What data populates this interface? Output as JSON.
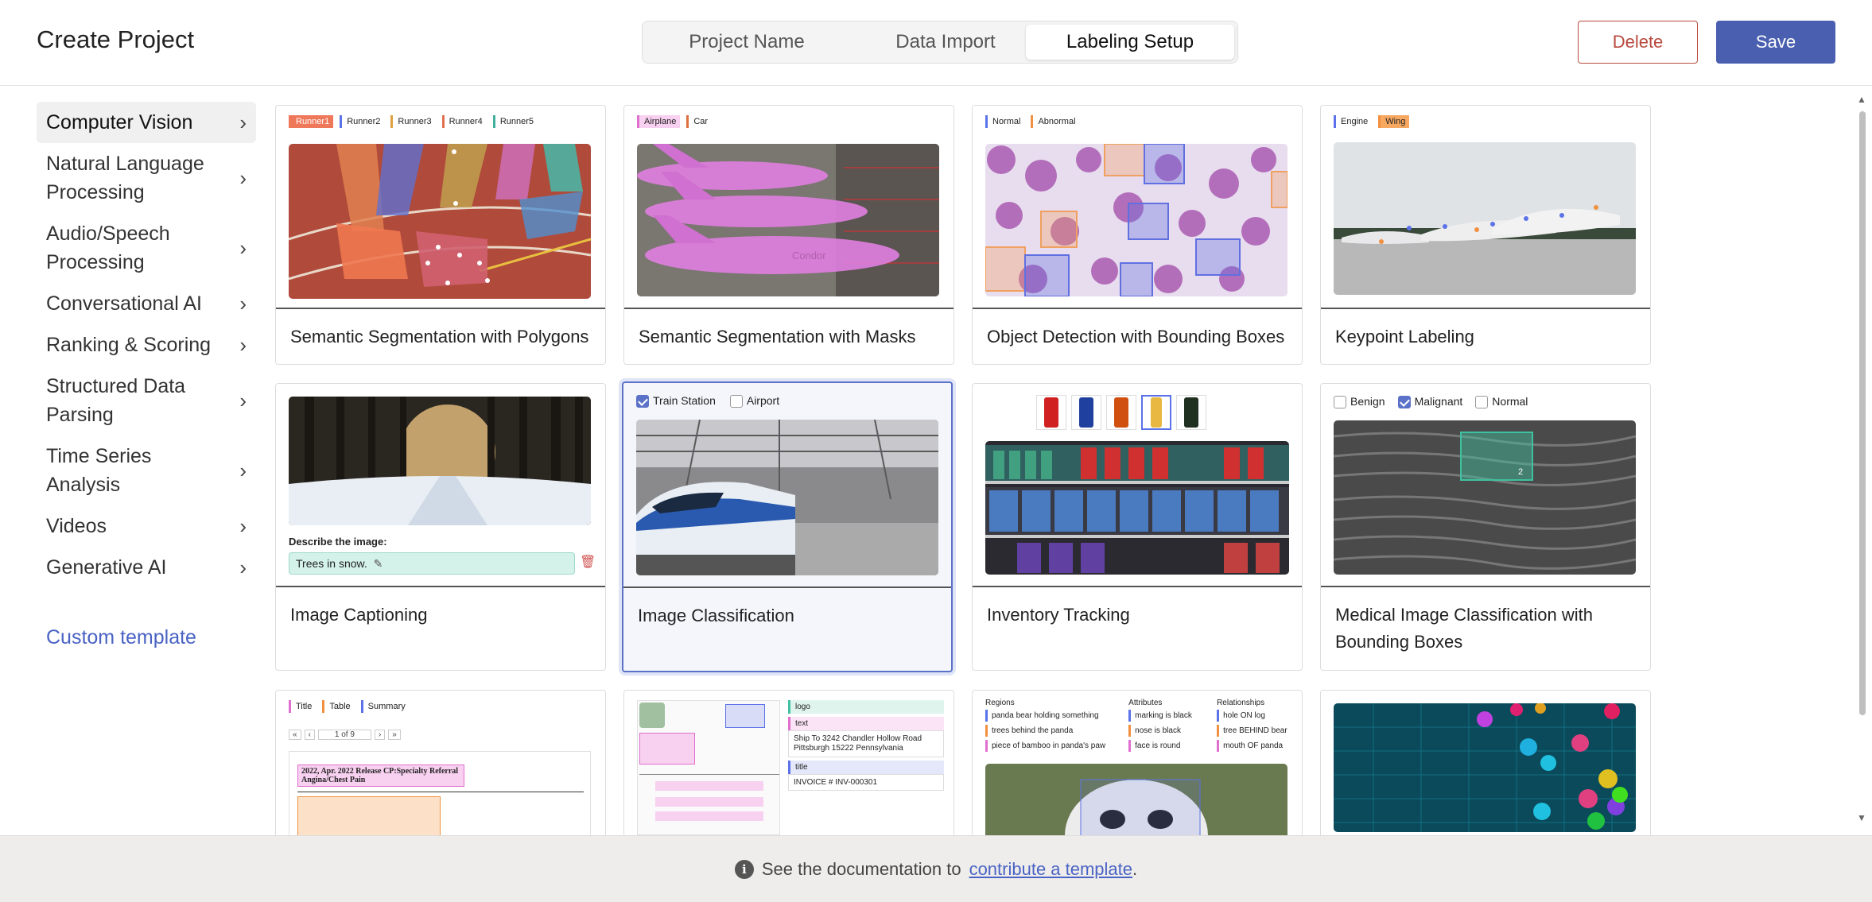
{
  "header": {
    "title": "Create Project",
    "tabs": [
      {
        "label": "Project Name"
      },
      {
        "label": "Data Import"
      },
      {
        "label": "Labeling Setup"
      }
    ],
    "delete_label": "Delete",
    "save_label": "Save"
  },
  "sidebar": {
    "items": [
      {
        "label": "Computer Vision"
      },
      {
        "label": "Natural Language Processing"
      },
      {
        "label": "Audio/Speech Processing"
      },
      {
        "label": "Conversational AI"
      },
      {
        "label": "Ranking & Scoring"
      },
      {
        "label": "Structured Data Parsing"
      },
      {
        "label": "Time Series Analysis"
      },
      {
        "label": "Videos"
      },
      {
        "label": "Generative AI"
      }
    ],
    "custom_template": "Custom template"
  },
  "cards": {
    "c1": {
      "title": "Semantic Segmentation with Polygons",
      "tags": [
        "Runner1",
        "Runner2",
        "Runner3",
        "Runner4",
        "Runner5"
      ]
    },
    "c2": {
      "title": "Semantic Segmentation with Masks",
      "tags": [
        "Airplane",
        "Car"
      ]
    },
    "c3": {
      "title": "Object Detection with Bounding Boxes",
      "tags": [
        "Normal",
        "Abnormal"
      ]
    },
    "c4": {
      "title": "Keypoint Labeling",
      "tags": [
        "Engine",
        "Wing"
      ]
    },
    "c5": {
      "title": "Image Captioning",
      "prompt": "Describe the image:",
      "caption": "Trees in snow."
    },
    "c6": {
      "title": "Image Classification",
      "choices": [
        "Train Station",
        "Airport"
      ]
    },
    "c7": {
      "title": "Inventory Tracking"
    },
    "c8": {
      "title": "Medical Image Classification with Bounding Boxes",
      "choices": [
        "Benign",
        "Malignant",
        "Normal"
      ]
    },
    "c9": {
      "tags": [
        "Title",
        "Table",
        "Summary"
      ],
      "pager": "1 of 9",
      "doc_heading": "2022, Apr. 2022 Release CP:Specialty Referral Angina/Chest Pain"
    },
    "c10": {
      "fields": [
        "logo",
        "text",
        "title"
      ],
      "ship_to": "Ship To 3242 Chandler Hollow Road Pittsburgh 15222 Pennsylvania",
      "invoice": "INVOICE # INV-000301"
    },
    "c11": {
      "headers": [
        "Regions",
        "Attributes",
        "Relationships"
      ],
      "regions": [
        "panda bear holding something",
        "trees behind the panda",
        "piece of bamboo in panda's paw"
      ],
      "attributes": [
        "marking is black",
        "nose is black",
        "face is round"
      ],
      "relationships": [
        "hole ON log",
        "tree BEHIND bear",
        "mouth OF panda"
      ]
    },
    "c12": {}
  },
  "footer": {
    "prefix": "See the documentation to",
    "link": "contribute a template",
    "suffix": "."
  },
  "colors": {
    "accent": "#4a5fb0",
    "danger": "#b84a3f",
    "link": "#4a63c4"
  }
}
